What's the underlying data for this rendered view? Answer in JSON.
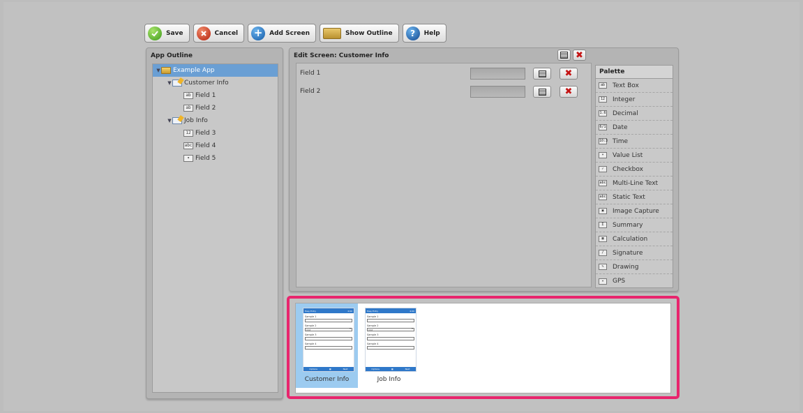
{
  "toolbar": {
    "save": "Save",
    "cancel": "Cancel",
    "add_screen": "Add Screen",
    "show_outline": "Show Outline",
    "help": "Help"
  },
  "outline": {
    "title": "App Outline",
    "items": [
      {
        "label": "Example App",
        "level": 0,
        "icon": "folder-icon",
        "expanded": true,
        "selected": true
      },
      {
        "label": "Customer Info",
        "level": 1,
        "icon": "screen-icon",
        "expanded": true,
        "selected": false
      },
      {
        "label": "Field 1",
        "level": 2,
        "icon": "text-box-icon",
        "selected": false
      },
      {
        "label": "Field 2",
        "level": 2,
        "icon": "text-box-icon",
        "selected": false
      },
      {
        "label": "Job Info",
        "level": 1,
        "icon": "screen-icon",
        "expanded": true,
        "selected": false
      },
      {
        "label": "Field 3",
        "level": 2,
        "icon": "integer-icon",
        "selected": false
      },
      {
        "label": "Field 4",
        "level": 2,
        "icon": "multi-line-text-icon",
        "selected": false
      },
      {
        "label": "Field 5",
        "level": 2,
        "icon": "value-list-icon",
        "selected": false
      }
    ]
  },
  "editor": {
    "title": "Edit Screen: Customer Info",
    "fields": [
      {
        "label": "Field 1"
      },
      {
        "label": "Field 2"
      }
    ]
  },
  "palette": {
    "title": "Palette",
    "items": [
      {
        "label": "Text Box",
        "icon": "text-box-icon",
        "glyph": "ab"
      },
      {
        "label": "Integer",
        "icon": "integer-icon",
        "glyph": "12"
      },
      {
        "label": "Decimal",
        "icon": "decimal-icon",
        "glyph": "1.6"
      },
      {
        "label": "Date",
        "icon": "date-icon",
        "glyph": "6/1"
      },
      {
        "label": "Time",
        "icon": "time-icon",
        "glyph": "10:3"
      },
      {
        "label": "Value List",
        "icon": "value-list-icon",
        "glyph": "▾"
      },
      {
        "label": "Checkbox",
        "icon": "checkbox-icon",
        "glyph": "✓"
      },
      {
        "label": "Multi-Line Text",
        "icon": "multi-line-text-icon",
        "glyph": "abc"
      },
      {
        "label": "Static Text",
        "icon": "static-text-icon",
        "glyph": "abc"
      },
      {
        "label": "Image Capture",
        "icon": "camera-icon",
        "glyph": "▣"
      },
      {
        "label": "Summary",
        "icon": "sigma-icon",
        "glyph": "Σ"
      },
      {
        "label": "Calculation",
        "icon": "calculator-icon",
        "glyph": "▦"
      },
      {
        "label": "Signature",
        "icon": "pen-icon",
        "glyph": "/"
      },
      {
        "label": "Drawing",
        "icon": "drawing-icon",
        "glyph": "✎"
      },
      {
        "label": "GPS",
        "icon": "satellite-icon",
        "glyph": "✦"
      }
    ]
  },
  "preview": {
    "screens": [
      {
        "caption": "Customer Info",
        "selected": true,
        "status_left": "Easy Entry",
        "status_right": "4:00",
        "rows": [
          {
            "label": "Sample 1",
            "kind": "input"
          },
          {
            "label": "Sample 2",
            "kind": "select",
            "value": "Chit"
          },
          {
            "label": "Sample 3",
            "kind": "input"
          },
          {
            "label": "Sample 4",
            "kind": "input"
          }
        ],
        "footer_left": "Options",
        "footer_right": "Next"
      },
      {
        "caption": "Job Info",
        "selected": false,
        "status_left": "Easy Entry",
        "status_right": "4:00",
        "rows": [
          {
            "label": "Sample 1",
            "kind": "input"
          },
          {
            "label": "Sample 2",
            "kind": "select",
            "value": "Chit"
          },
          {
            "label": "Sample 3",
            "kind": "input"
          },
          {
            "label": "Sample 4",
            "kind": "input"
          }
        ],
        "footer_left": "Options",
        "footer_right": "Next"
      }
    ]
  },
  "colors": {
    "selection": "#6a9fd4",
    "highlight_border": "#e8256d",
    "delete_red": "#c41414"
  }
}
